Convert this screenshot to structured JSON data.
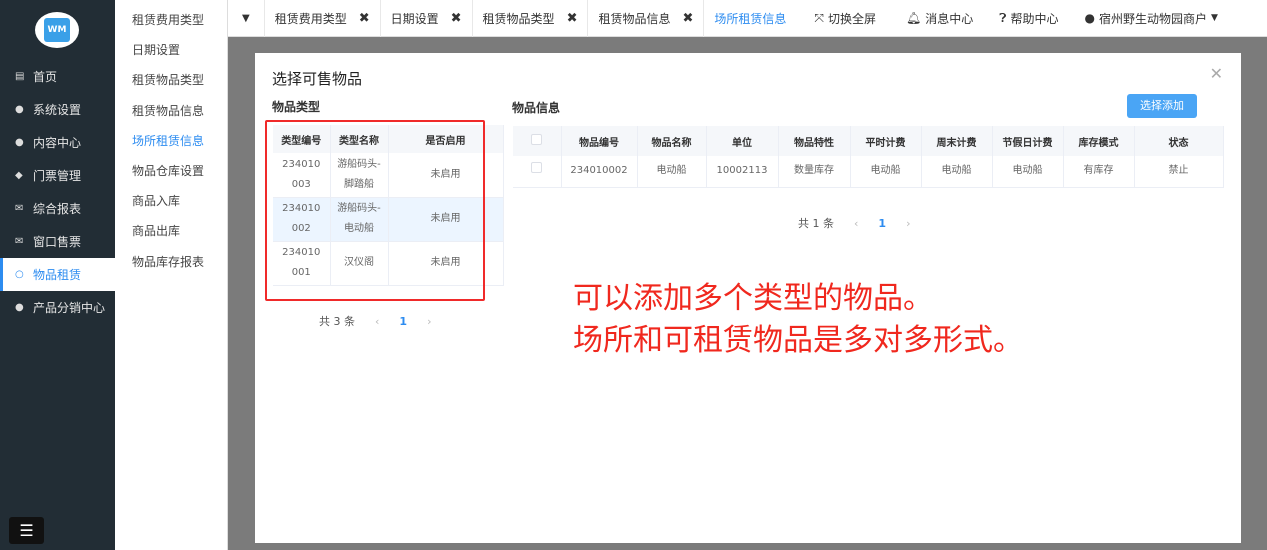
{
  "sidebar": {
    "logo_text": "WM",
    "items": [
      {
        "label": "首页",
        "icon": "home-icon",
        "glyph": "▤"
      },
      {
        "label": "系统设置",
        "icon": "user-icon",
        "glyph": "●"
      },
      {
        "label": "内容中心",
        "icon": "user-icon",
        "glyph": "●"
      },
      {
        "label": "门票管理",
        "icon": "ticket-icon",
        "glyph": "◆"
      },
      {
        "label": "综合报表",
        "icon": "envelope-icon",
        "glyph": "✉"
      },
      {
        "label": "窗口售票",
        "icon": "envelope-icon",
        "glyph": "✉"
      },
      {
        "label": "物品租赁",
        "icon": "circle-icon",
        "glyph": "○"
      },
      {
        "label": "产品分销中心",
        "icon": "user-icon",
        "glyph": "●"
      }
    ],
    "collapse_glyph": "☰"
  },
  "submenu": [
    "租赁费用类型",
    "日期设置",
    "租赁物品类型",
    "租赁物品信息",
    "场所租赁信息",
    "物品仓库设置",
    "商品入库",
    "商品出库",
    "物品库存报表"
  ],
  "tabs": [
    "租赁费用类型",
    "日期设置",
    "租赁物品类型",
    "租赁物品信息",
    "场所租赁信息"
  ],
  "toolbar": {
    "fullscreen": "切换全屏",
    "messages": "消息中心",
    "help": "帮助中心",
    "user": "宿州野生动物园商户"
  },
  "modal": {
    "title": "选择可售物品",
    "left_title": "物品类型",
    "right_title": "物品信息",
    "add_button": "选择添加",
    "type_table": {
      "headers": [
        "类型编号",
        "类型名称",
        "是否启用"
      ],
      "rows": [
        [
          "234010003",
          "游船码头-脚踏船",
          "未启用"
        ],
        [
          "234010002",
          "游船码头-电动船",
          "未启用"
        ],
        [
          "234010001",
          "汉仪阁",
          "未启用"
        ]
      ]
    },
    "type_pager": {
      "total": "共 3 条",
      "page": "1"
    },
    "item_table": {
      "headers": [
        "物品编号",
        "物品名称",
        "单位",
        "物品特性",
        "平时计费",
        "周末计费",
        "节假日计费",
        "库存模式",
        "状态"
      ],
      "rows": [
        [
          "234010002",
          "电动船",
          "10002113",
          "数量库存",
          "电动船",
          "电动船",
          "电动船",
          "有库存",
          "禁止"
        ]
      ]
    },
    "item_pager": {
      "total": "共 1 条",
      "page": "1"
    }
  },
  "annotation": [
    "可以添加多个类型的物品。",
    "场所和可租赁物品是多对多形式。"
  ],
  "colors": {
    "accent": "#2d8cf0",
    "sidebar": "#222d35",
    "annotation": "#f0281e"
  }
}
